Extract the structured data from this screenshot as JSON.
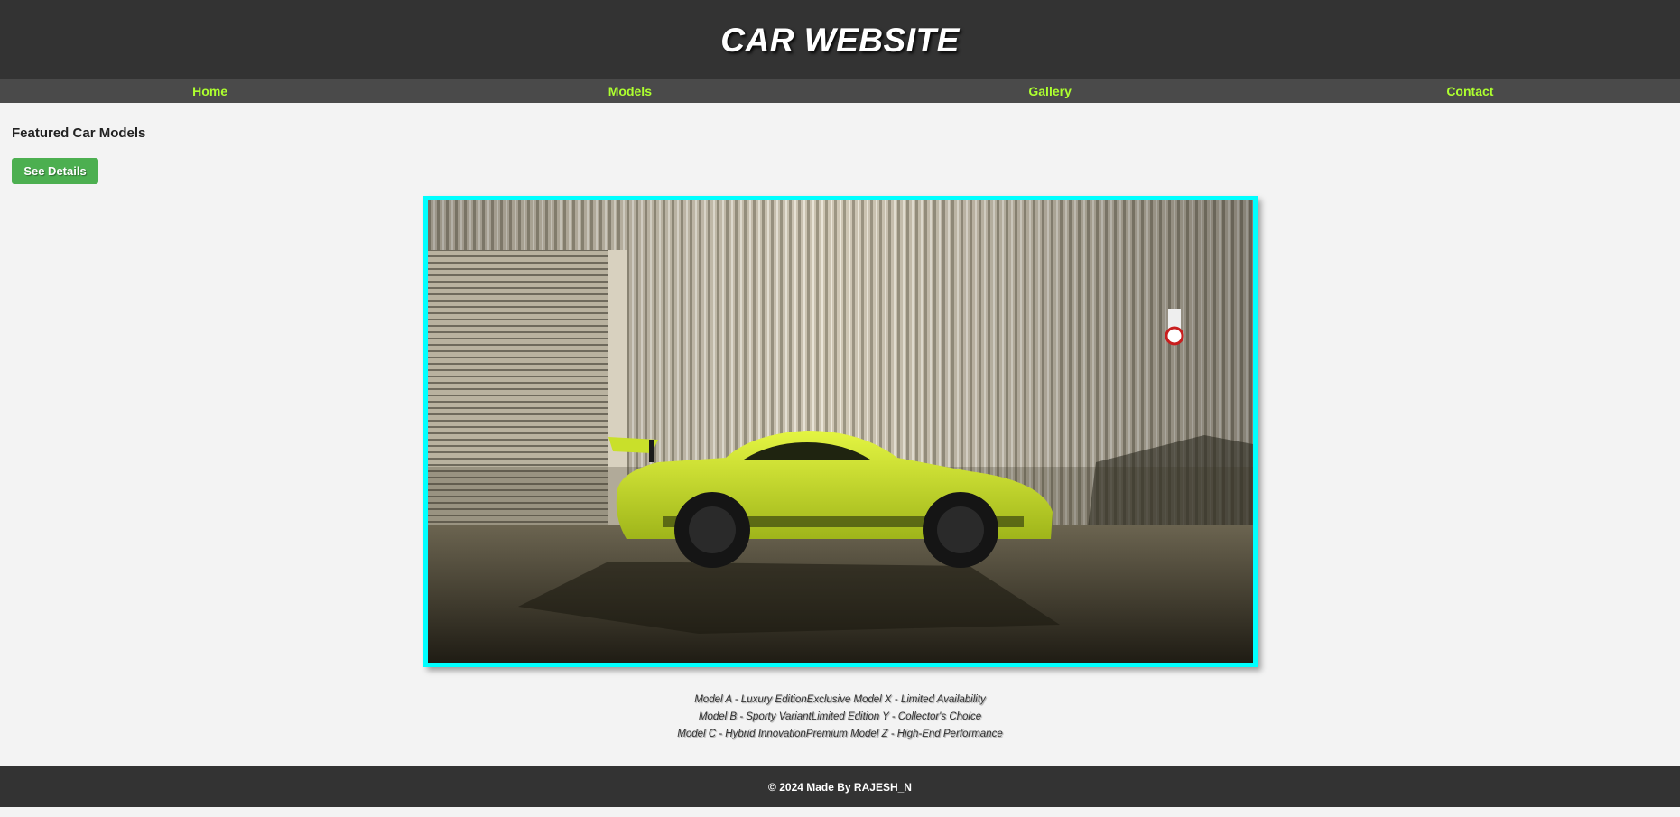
{
  "header": {
    "title": "CAR WEBSITE"
  },
  "nav": {
    "items": [
      "Home",
      "Models",
      "Gallery",
      "Contact"
    ]
  },
  "main": {
    "section_title": "Featured Car Models",
    "details_button": "See Details",
    "captions": [
      "Model A - Luxury EditionExclusive Model X - Limited Availability",
      "Model B - Sporty VariantLimited Edition Y - Collector's Choice",
      "Model C - Hybrid InnovationPremium Model Z - High-End Performance"
    ]
  },
  "footer": {
    "text": "© 2024 Made By RAJESH_N"
  },
  "colors": {
    "nav_link": "#adff2f",
    "button": "#4caf50",
    "frame_border": "#00ffff",
    "bar": "#333333"
  }
}
